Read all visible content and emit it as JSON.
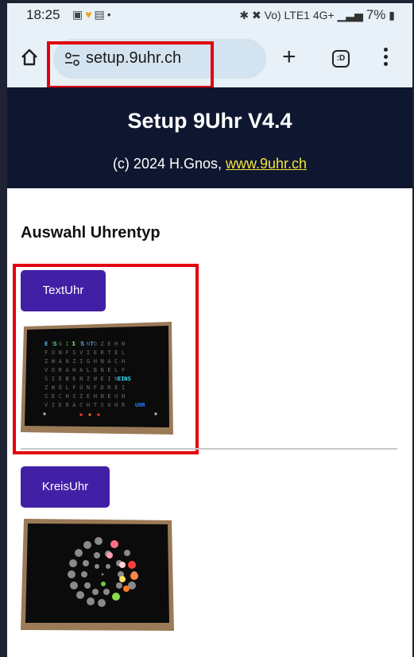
{
  "status_bar": {
    "time": "18:25",
    "left_icons": [
      "notification-icon",
      "sync-icon",
      "gallery-icon",
      "dot-icon"
    ],
    "right_text": "Vo) LTE1 4G+",
    "battery": "7%"
  },
  "browser": {
    "url": "setup.9uhr.ch",
    "tab_button_label": ":D"
  },
  "header": {
    "title": "Setup 9Uhr V4.4",
    "copyright_prefix": "(c) 2024 H.Gnos, ",
    "link_text": "www.9uhr.ch"
  },
  "main": {
    "section_title": "Auswahl Uhrentyp",
    "options": [
      {
        "label": "TextUhr"
      },
      {
        "label": "KreisUhr"
      }
    ]
  },
  "colors": {
    "header_bg": "#0f1730",
    "button_bg": "#4220a6",
    "link_color": "#f4e23a",
    "highlight": "#e3000b"
  }
}
